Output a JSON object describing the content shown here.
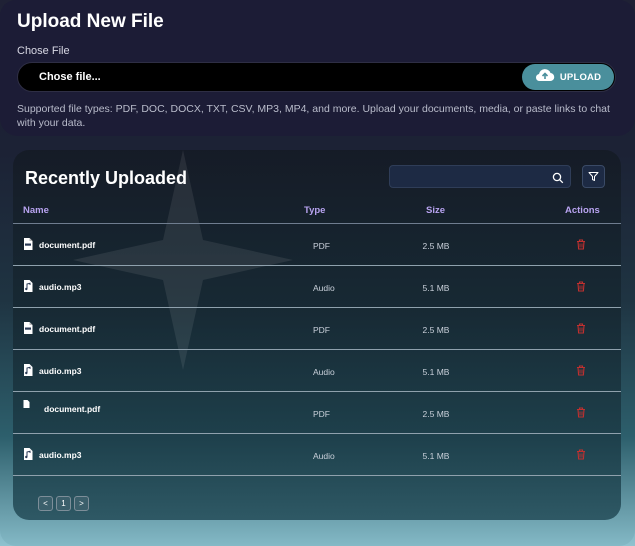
{
  "upload": {
    "title": "Upload New File",
    "chose_label": "Chose File",
    "file_placeholder": "Chose file...",
    "upload_button": "UPLOAD",
    "supported_text": "Supported file types: PDF, DOC, DOCX, TXT, CSV, MP3, MP4, and more. Upload your documents, media, or paste links to chat with your data."
  },
  "recent": {
    "title": "Recently Uploaded",
    "search_value": "",
    "columns": {
      "name": "Name",
      "type": "Type",
      "size": "Size",
      "actions": "Actions"
    },
    "rows": [
      {
        "name": "document.pdf",
        "type": "PDF",
        "size": "2.5 MB",
        "icon": "pdf-file-icon"
      },
      {
        "name": "audio.mp3",
        "type": "Audio",
        "size": "5.1 MB",
        "icon": "audio-file-icon"
      },
      {
        "name": "document.pdf",
        "type": "PDF",
        "size": "2.5 MB",
        "icon": "pdf-file-icon"
      },
      {
        "name": "audio.mp3",
        "type": "Audio",
        "size": "5.1 MB",
        "icon": "audio-file-icon"
      },
      {
        "name": "document.pdf",
        "type": "PDF",
        "size": "2.5 MB",
        "icon": "file-icon"
      },
      {
        "name": "audio.mp3",
        "type": "Audio",
        "size": "5.1 MB",
        "icon": "audio-file-icon"
      }
    ],
    "pagination": {
      "prev": "<",
      "current": "1",
      "next": ">"
    }
  },
  "colors": {
    "accent": "#4a8f9c",
    "header_text": "#b8a3f0",
    "delete": "#c0302f"
  }
}
